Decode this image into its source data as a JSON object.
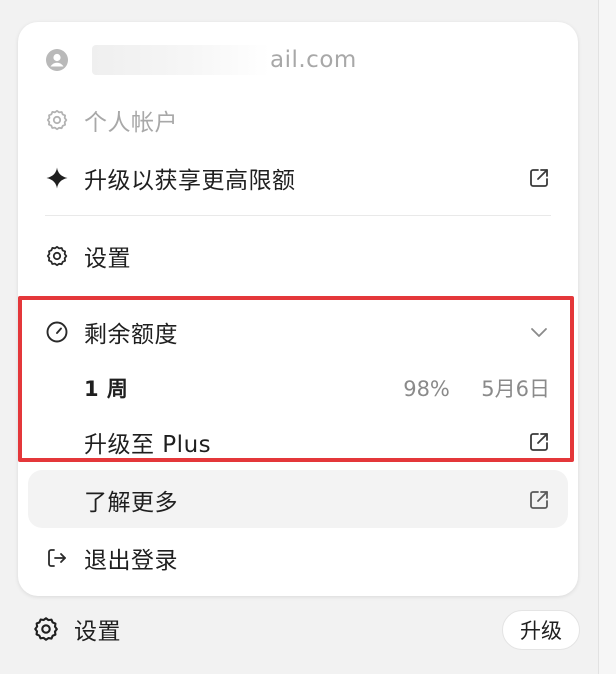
{
  "menu": {
    "account": {
      "email_suffix": "ail.com",
      "icon": "user-circle-icon"
    },
    "personal_account": {
      "label": "个人帐户",
      "icon": "gear-icon"
    },
    "upgrade_limit": {
      "label": "升级以获享更高限额",
      "icon": "sparkle-icon",
      "trailing_icon": "external-link-icon"
    },
    "settings": {
      "label": "设置",
      "icon": "gear-icon"
    },
    "quota": {
      "label": "剩余额度",
      "icon": "gauge-icon",
      "chevron": "chevron-down-icon",
      "period": "1 周",
      "percent": "98%",
      "reset_date": "5月6日",
      "upgrade_label": "升级至 Plus"
    },
    "learn_more": {
      "label": "了解更多"
    },
    "logout": {
      "label": "退出登录",
      "icon": "logout-icon"
    }
  },
  "bottom_bar": {
    "settings_label": "设置",
    "settings_icon": "gear-icon",
    "upgrade_button": "升级"
  },
  "colors": {
    "highlight_border": "#e4373a",
    "menu_background": "#ffffff",
    "muted_text": "#a8a8a8"
  }
}
